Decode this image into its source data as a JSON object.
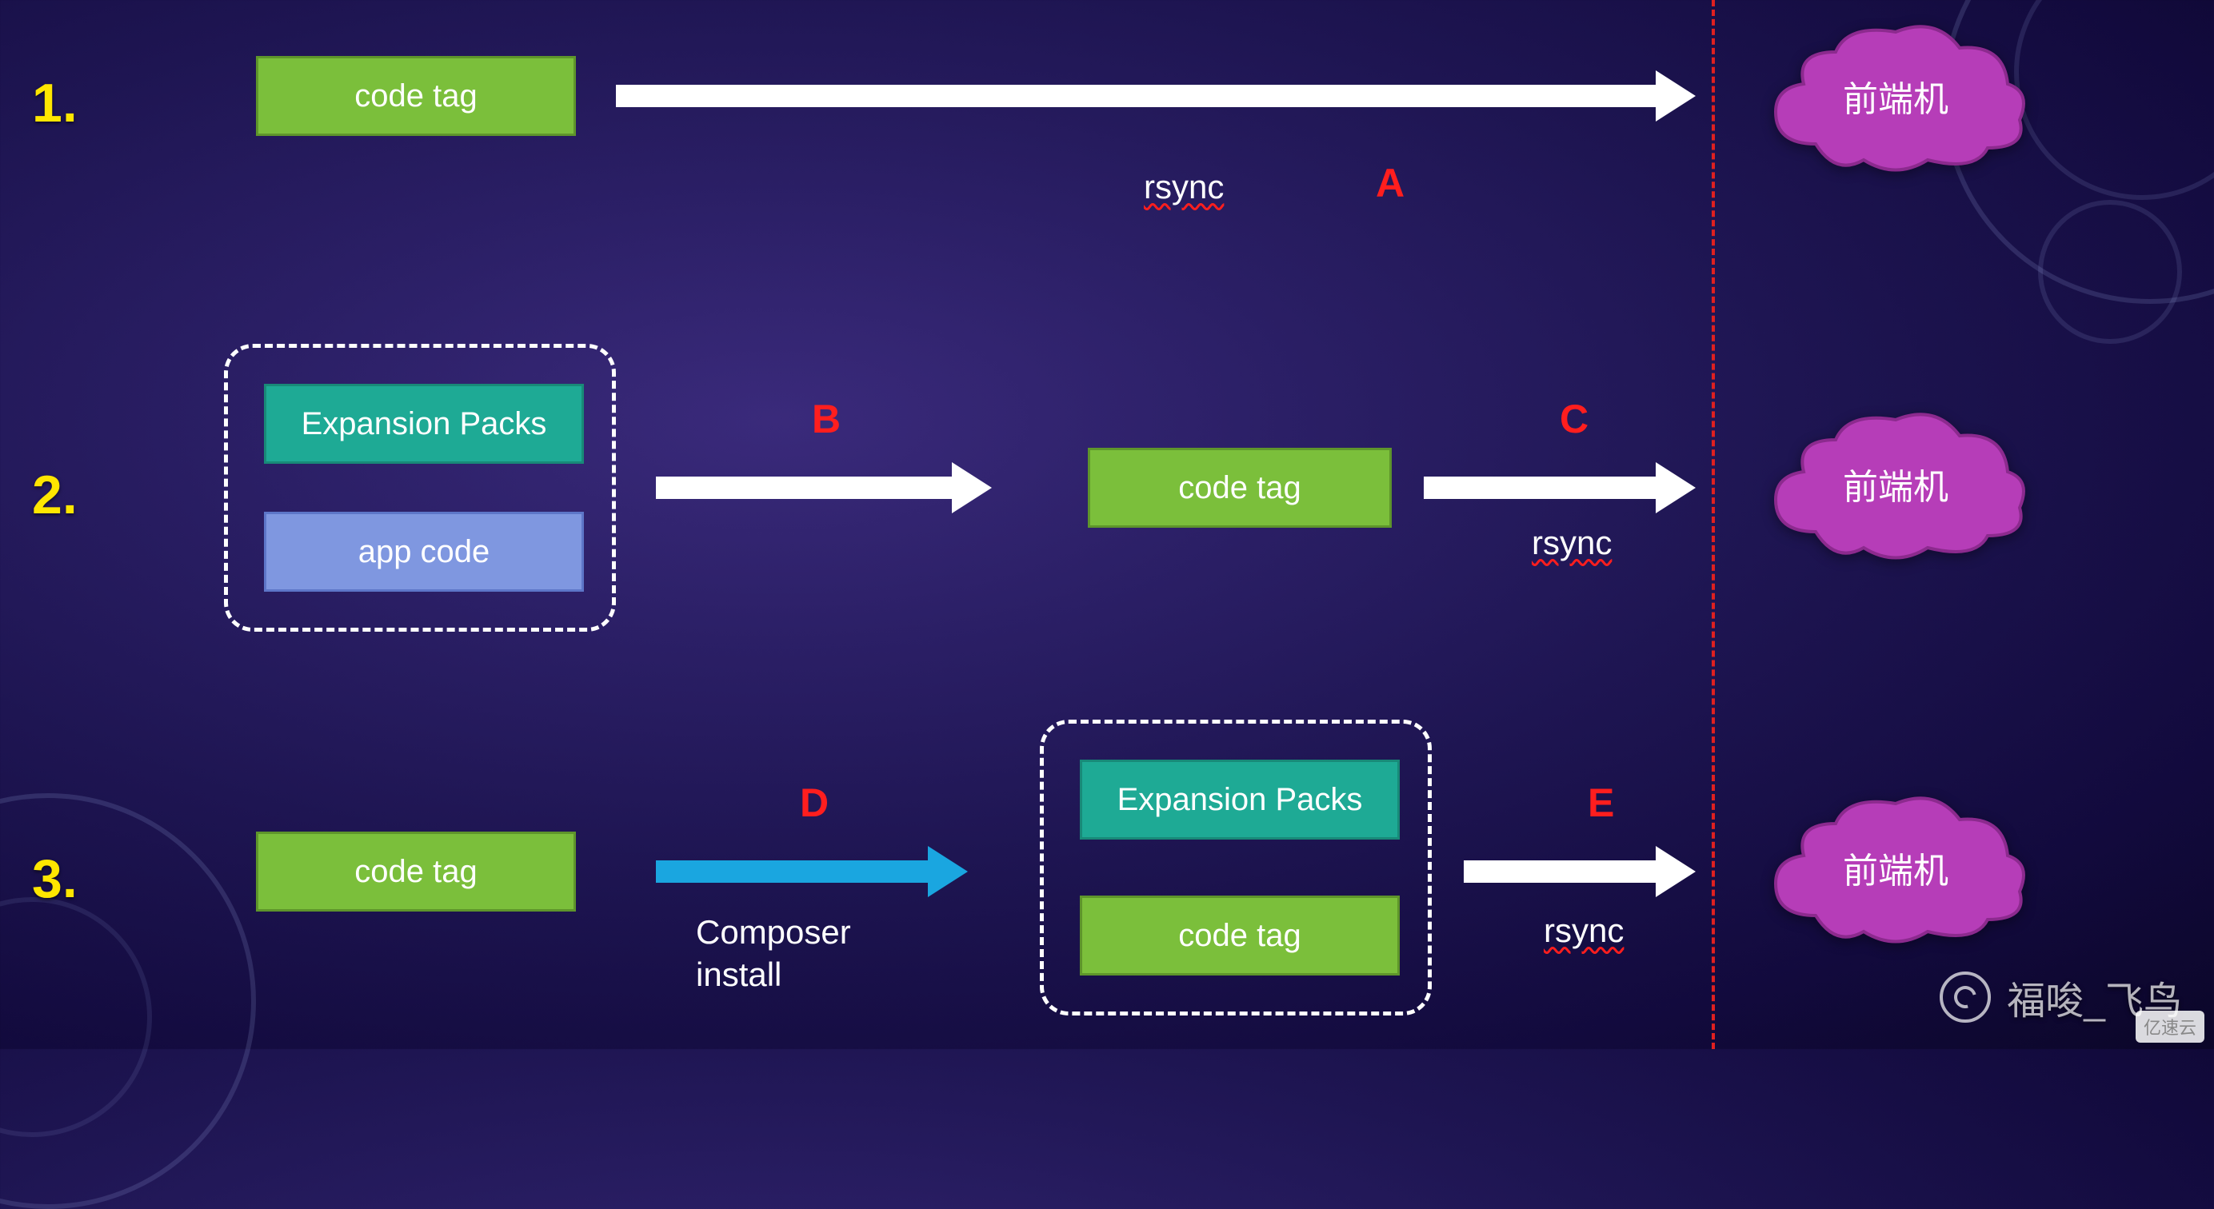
{
  "colors": {
    "stepNumber": "#ffe600",
    "labelRed": "#ff1e1e",
    "boxGreen": "#7bbf3b",
    "boxTeal": "#1eaa95",
    "boxBlue": "#7f97e0",
    "arrowWhite": "#ffffff",
    "arrowCyan": "#1aa6e0",
    "cloudFill": "#b63db8",
    "dividerRed": "#e02020"
  },
  "layout": {
    "dividerX": 2140
  },
  "steps": {
    "s1": "1.",
    "s2": "2.",
    "s3": "3."
  },
  "row1": {
    "box": "code tag",
    "arrowLabel": "rsync",
    "letter": "A",
    "cloud": "前端机"
  },
  "row2": {
    "groupTop": "Expansion Packs",
    "groupBottom": "app code",
    "letterB": "B",
    "midBox": "code tag",
    "letterC": "C",
    "arrowLabel": "rsync",
    "cloud": "前端机"
  },
  "row3": {
    "leftBox": "code tag",
    "letterD": "D",
    "arrowLabel": "Composer\ninstall",
    "groupTop": "Expansion Packs",
    "groupBottom": "code tag",
    "letterE": "E",
    "arrowLabel2": "rsync",
    "cloud": "前端机"
  },
  "watermark": "福唆_飞鸟",
  "cornerBadge": "亿速云"
}
